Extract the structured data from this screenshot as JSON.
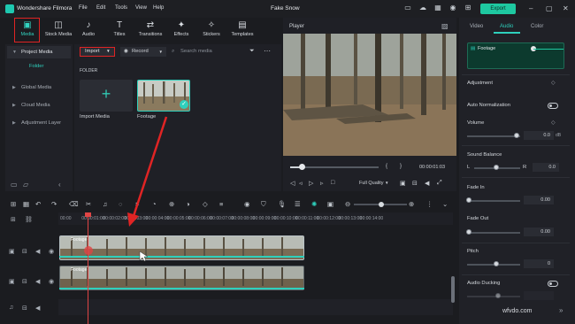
{
  "app": {
    "name": "Wondershare Filmora",
    "menu": [
      "File",
      "Edit",
      "Tools",
      "View",
      "Help"
    ],
    "document_title": "Fake Snow",
    "export_label": "Export"
  },
  "ribbon": {
    "items": [
      {
        "label": "Media",
        "icon": "media-icon"
      },
      {
        "label": "Stock Media",
        "icon": "stock-media-icon"
      },
      {
        "label": "Audio",
        "icon": "music-note-icon"
      },
      {
        "label": "Titles",
        "icon": "titles-icon"
      },
      {
        "label": "Transitions",
        "icon": "transitions-icon"
      },
      {
        "label": "Effects",
        "icon": "effects-icon"
      },
      {
        "label": "Stickers",
        "icon": "stickers-icon"
      },
      {
        "label": "Templates",
        "icon": "templates-icon"
      }
    ]
  },
  "leftnav": {
    "project_media": "Project Media",
    "folder": "Folder",
    "items": [
      "Global Media",
      "Cloud Media",
      "Adjustment Layer"
    ]
  },
  "browser": {
    "import_label": "Import",
    "record_label": "Record",
    "search_placeholder": "Search media",
    "folder_header": "FOLDER",
    "import_tile_label": "Import Media",
    "footage_tile_label": "Footage"
  },
  "player": {
    "label": "Player",
    "time": "00:00:01:03",
    "quality": "Full Quality"
  },
  "right_panel": {
    "tabs": [
      "Video",
      "Audio",
      "Color"
    ],
    "active_tab": "Audio",
    "clip_name": "Footage",
    "adjustment": "Adjustment",
    "auto_normalization": "Auto Normalization",
    "volume": {
      "label": "Volume",
      "value": "0.0",
      "unit": "dB"
    },
    "sound_balance": {
      "label": "Sound Balance",
      "left": "L",
      "right": "R",
      "value": "0.0"
    },
    "fade_in": {
      "label": "Fade In",
      "value": "0.00"
    },
    "fade_out": {
      "label": "Fade Out",
      "value": "0.00"
    },
    "pitch": {
      "label": "Pitch",
      "value": "0"
    },
    "audio_ducking": {
      "label": "Audio Ducking"
    }
  },
  "timeline": {
    "ruler": [
      "00:00",
      "00:00:01:00",
      "00:00:02:00",
      "00:00:03:00",
      "00:00:04:00",
      "00:00:05:00",
      "00:00:06:00",
      "00:00:07:00",
      "00:00:08:00",
      "00:00:09:00",
      "00:00:10:00",
      "00:00:11:00",
      "00:00:12:00",
      "00:00:13:00",
      "00:00:14:00"
    ],
    "clip_top_name": "Footage",
    "clip_bottom_name": "Footage"
  },
  "watermark": "wfvdo.com",
  "colors": {
    "accent": "#2ed0bc",
    "highlight_box": "#e02424",
    "export": "#1ec8a0"
  }
}
